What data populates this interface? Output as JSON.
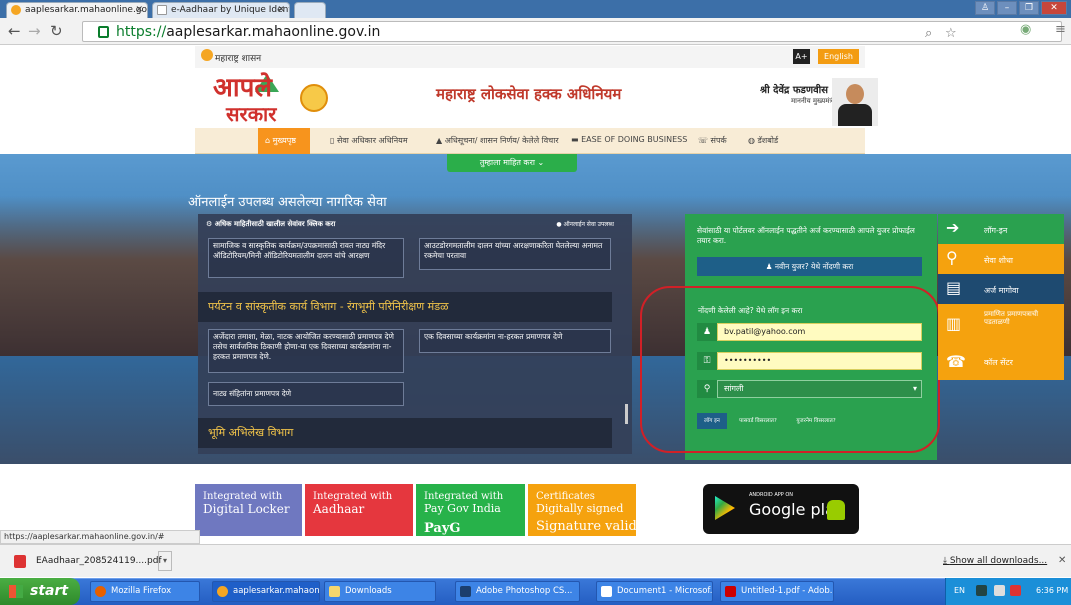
{
  "browser": {
    "tabs": [
      {
        "title": "aaplesarkar.mahaonline.gov",
        "active": true
      },
      {
        "title": "e-Aadhaar by Unique Identi",
        "active": false
      }
    ],
    "url_scheme": "https://",
    "url_host": "aaplesarkar.mahaonline.gov.in",
    "status_url": "https://aaplesarkar.mahaonline.gov.in/#"
  },
  "header": {
    "gov_label": "महाराष्ट्र शासन",
    "font_btn": "A+",
    "lang_btn": "English",
    "logo_line1": "आपले",
    "logo_line2": "सरकार",
    "act_title": "महाराष्ट्र लोकसेवा हक्क अधिनियम",
    "cm_name": "श्री देवेंद्र फडणवीस",
    "cm_role": "माननीय मुख्यमंत्री"
  },
  "nav": {
    "items": [
      "मुख्यपृष्ठ",
      "सेवा अधिकार अधिनियम",
      "अधिसूचना/ शासन निर्णय/ केलेले विचार",
      "EASE OF DOING BUSINESS",
      "संपर्क",
      "डॅशबोर्ड"
    ],
    "dropdown": "तुम्हाला माहित करा"
  },
  "services": {
    "title": "ऑनलाईन उपलब्ध असलेल्या नागरिक सेवा",
    "header_left": "अधिक माहितीसाठी खालील सेवांवर क्लिक करा",
    "header_right": "ऑनलाईन सेवा उपलब्ध",
    "box1": "सामाजिक व सास्कृतिक कार्यक्रम/उपक्रमासाठी रावत नाट्य मंदिर ऑडिटोरियम/मिनी ऑडिटोरियमतालीम दालन यांचे आरक्षण",
    "box2": "आउटडोरगमतालीम दालन यांच्या आरक्षणाकरिता घेतलेल्या अनामत रकमेचा परतावा",
    "dept1": "पर्यटन व सांस्कृतीक कार्य विभाग - रंगभूमी परिनिरीक्षण मंडळ",
    "box3": "अर्जेदारा तमाशा, मेळा, नाटक आयोजित करण्यासाठी प्रमाणपत्र देणे तसेच सार्वजनिक ठिकाणी होणा-या एक दिवसाच्या कार्यक्रमांना ना-हरकत प्रमाणपत्र देणे.",
    "box4": "एक दिवसाच्या कार्यक्रमांना ना-हरकत प्रमाणपत्र देणे",
    "box5": "नाट्य संहितांना प्रमाणपत्र देणे",
    "dept2": "भूमि अभिलेख विभाग"
  },
  "login": {
    "reg_text": "सेवांसाठी या पोर्टलवर ऑनलाईन पद्धतीने अर्ज करण्यासाठी आपले युजर प्रोफाईल तयार करा.",
    "reg_btn": "नवीन युजर? येथे नोंदणी करा",
    "prompt": "नोंदणी केलेली आहे? येथे लॉग इन करा",
    "username": "bv.patil@yahoo.com",
    "password": "••••••••••",
    "district": "सांगली",
    "btn_login": "लॉग इन",
    "btn_forgot_pwd": "पासवर्ड विसरलात?",
    "btn_forgot_user": "युजरनेम विसरलात?"
  },
  "quick_links": [
    "लॉग-इन",
    "सेवा शोधा",
    "अर्ज मागोवा",
    "प्रमाणित प्रमाणपत्राची पडताळणी",
    "कॉल सेंटर"
  ],
  "tiles": [
    {
      "l1": "Integrated with",
      "l2": "Digital Locker"
    },
    {
      "l1": "Integrated with",
      "l2": "Aadhaar"
    },
    {
      "l1": "Integrated with",
      "l2": "Pay Gov India",
      "l3": "PayG"
    },
    {
      "l1": "Certificates",
      "l2": "Digitally signed",
      "l3": "Signature valid"
    }
  ],
  "gplay": {
    "small": "ANDROID APP ON",
    "big": "Google play"
  },
  "downloads": {
    "file": "EAadhaar_208524119....pdf",
    "show_all": "Show all downloads..."
  },
  "taskbar": {
    "start": "start",
    "tasks": [
      "Mozilla Firefox",
      "aaplesarkar.mahaonli...",
      "Downloads",
      "Adobe Photoshop CS...",
      "Document1 - Microsof...",
      "Untitled-1.pdf - Adob..."
    ],
    "lang": "EN",
    "clock": "6:36 PM"
  }
}
